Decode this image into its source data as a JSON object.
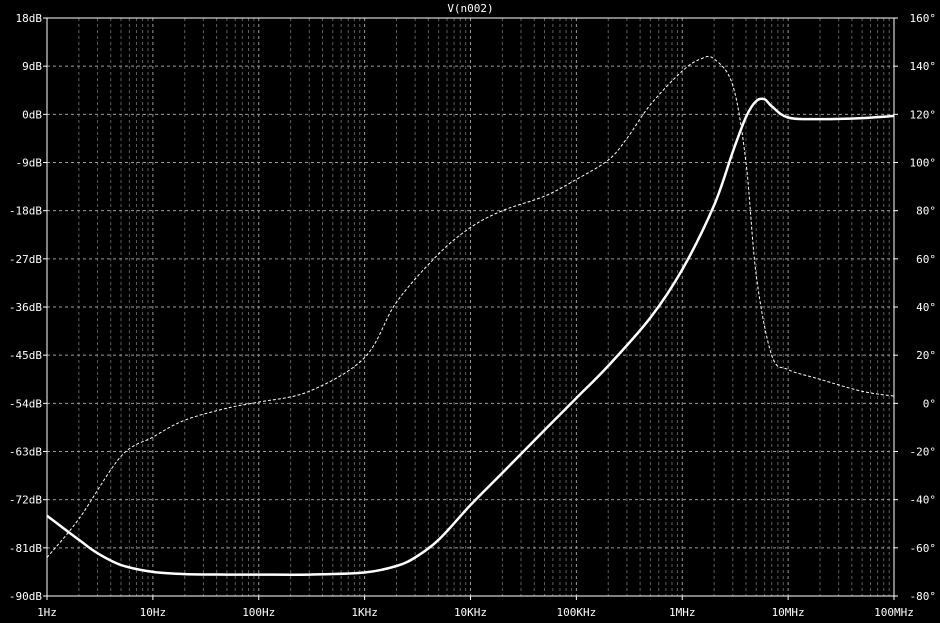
{
  "chart_data": {
    "type": "line",
    "title": "V(n002)",
    "x_scale": "log",
    "xlim": [
      1,
      100000000
    ],
    "x_ticks": [
      1,
      10,
      100,
      1000,
      10000,
      100000,
      1000000,
      10000000,
      100000000
    ],
    "x_tick_labels": [
      "1Hz",
      "10Hz",
      "100Hz",
      "1KHz",
      "10KHz",
      "100KHz",
      "1MHz",
      "10MHz",
      "100MHz"
    ],
    "y_left": {
      "lim": [
        -90,
        18
      ],
      "ticks": [
        18,
        9,
        0,
        -9,
        -18,
        -27,
        -36,
        -45,
        -54,
        -63,
        -72,
        -81,
        -90
      ],
      "tick_labels": [
        "18dB",
        "9dB",
        "0dB",
        "-9dB",
        "-18dB",
        "-27dB",
        "-36dB",
        "-45dB",
        "-54dB",
        "-63dB",
        "-72dB",
        "-81dB",
        "-90dB"
      ]
    },
    "y_right": {
      "lim": [
        -80,
        160
      ],
      "ticks": [
        160,
        140,
        120,
        100,
        80,
        60,
        40,
        20,
        0,
        -20,
        -40,
        -60,
        -80
      ],
      "tick_labels": [
        "160°",
        "140°",
        "120°",
        "100°",
        "80°",
        "60°",
        "40°",
        "20°",
        "0°",
        "-20°",
        "-40°",
        "-60°",
        "-80°"
      ]
    },
    "grid": true,
    "background": "#000000",
    "series": [
      {
        "quantity": "magnitude_dB",
        "axis": "left",
        "style": "solid",
        "color": "#ffffff",
        "x": [
          1,
          2,
          3,
          5,
          10,
          20,
          50,
          100,
          300,
          1000,
          2000,
          3000,
          5000,
          10000,
          20000,
          50000,
          100000,
          200000,
          500000,
          1000000,
          2000000,
          3000000,
          4000000,
          5000000,
          6000000,
          7000000,
          10000000,
          20000000,
          50000000,
          100000000
        ],
        "y": [
          -75,
          -79.5,
          -82,
          -84.2,
          -85.5,
          -85.9,
          -86,
          -86,
          -86,
          -85.6,
          -84.4,
          -82.8,
          -79.5,
          -73,
          -67,
          -59,
          -53,
          -47,
          -38,
          -29,
          -17,
          -7,
          -0.5,
          2.5,
          2.8,
          1.5,
          -0.6,
          -0.9,
          -0.7,
          -0.3
        ]
      },
      {
        "quantity": "phase_deg",
        "axis": "right",
        "style": "dashed",
        "color": "#ffffff",
        "x": [
          1,
          2,
          5,
          10,
          20,
          50,
          100,
          300,
          1000,
          2000,
          5000,
          10000,
          20000,
          50000,
          100000,
          200000,
          300000,
          500000,
          1000000,
          1500000,
          2000000,
          3000000,
          4000000,
          5000000,
          7000000,
          10000000,
          20000000,
          50000000,
          100000000
        ],
        "y": [
          -64,
          -48,
          -22,
          -14,
          -7,
          -2,
          0.5,
          5,
          19,
          42,
          62,
          73,
          80,
          86,
          93,
          101,
          110,
          124,
          138,
          143,
          143,
          132,
          100,
          53,
          20,
          14,
          10,
          5,
          3
        ]
      }
    ]
  }
}
